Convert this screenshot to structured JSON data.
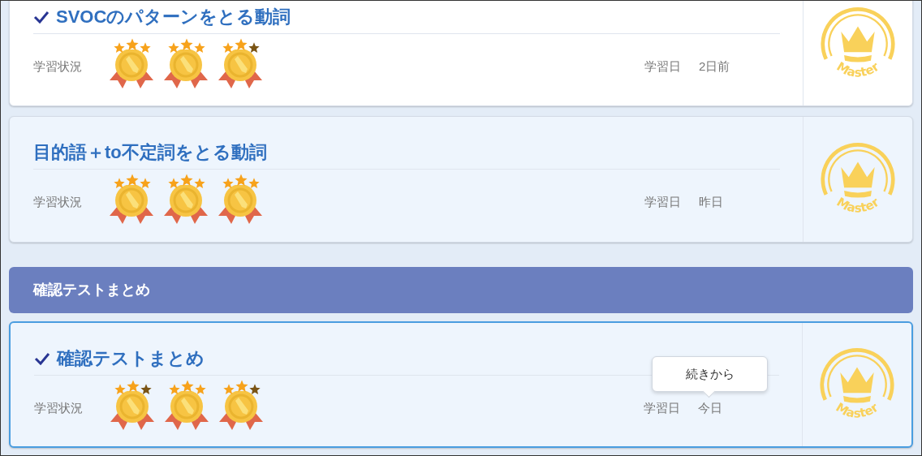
{
  "items": [
    {
      "kind": "card",
      "title": "SVOCのパターンをとる動詞",
      "completed": true,
      "selected": false,
      "status_label": "学習状況",
      "medals": [
        {
          "stars": 3
        },
        {
          "stars": 3
        },
        {
          "stars": 2
        }
      ],
      "date_label": "学習日",
      "date": "2日前",
      "badge": "Master"
    },
    {
      "kind": "card",
      "title": "目的語＋to不定詞をとる動詞",
      "completed": false,
      "selected": false,
      "status_label": "学習状況",
      "medals": [
        {
          "stars": 3
        },
        {
          "stars": 3
        },
        {
          "stars": 3
        }
      ],
      "date_label": "学習日",
      "date": "昨日",
      "badge": "Master"
    },
    {
      "kind": "header",
      "title": "確認テストまとめ"
    },
    {
      "kind": "card",
      "title": "確認テストまとめ",
      "completed": true,
      "selected": true,
      "status_label": "学習状況",
      "medals": [
        {
          "stars": 2
        },
        {
          "stars": 3
        },
        {
          "stars": 2
        }
      ],
      "date_label": "学習日",
      "date": "今日",
      "badge": "Master",
      "tooltip": "続きから"
    }
  ]
}
